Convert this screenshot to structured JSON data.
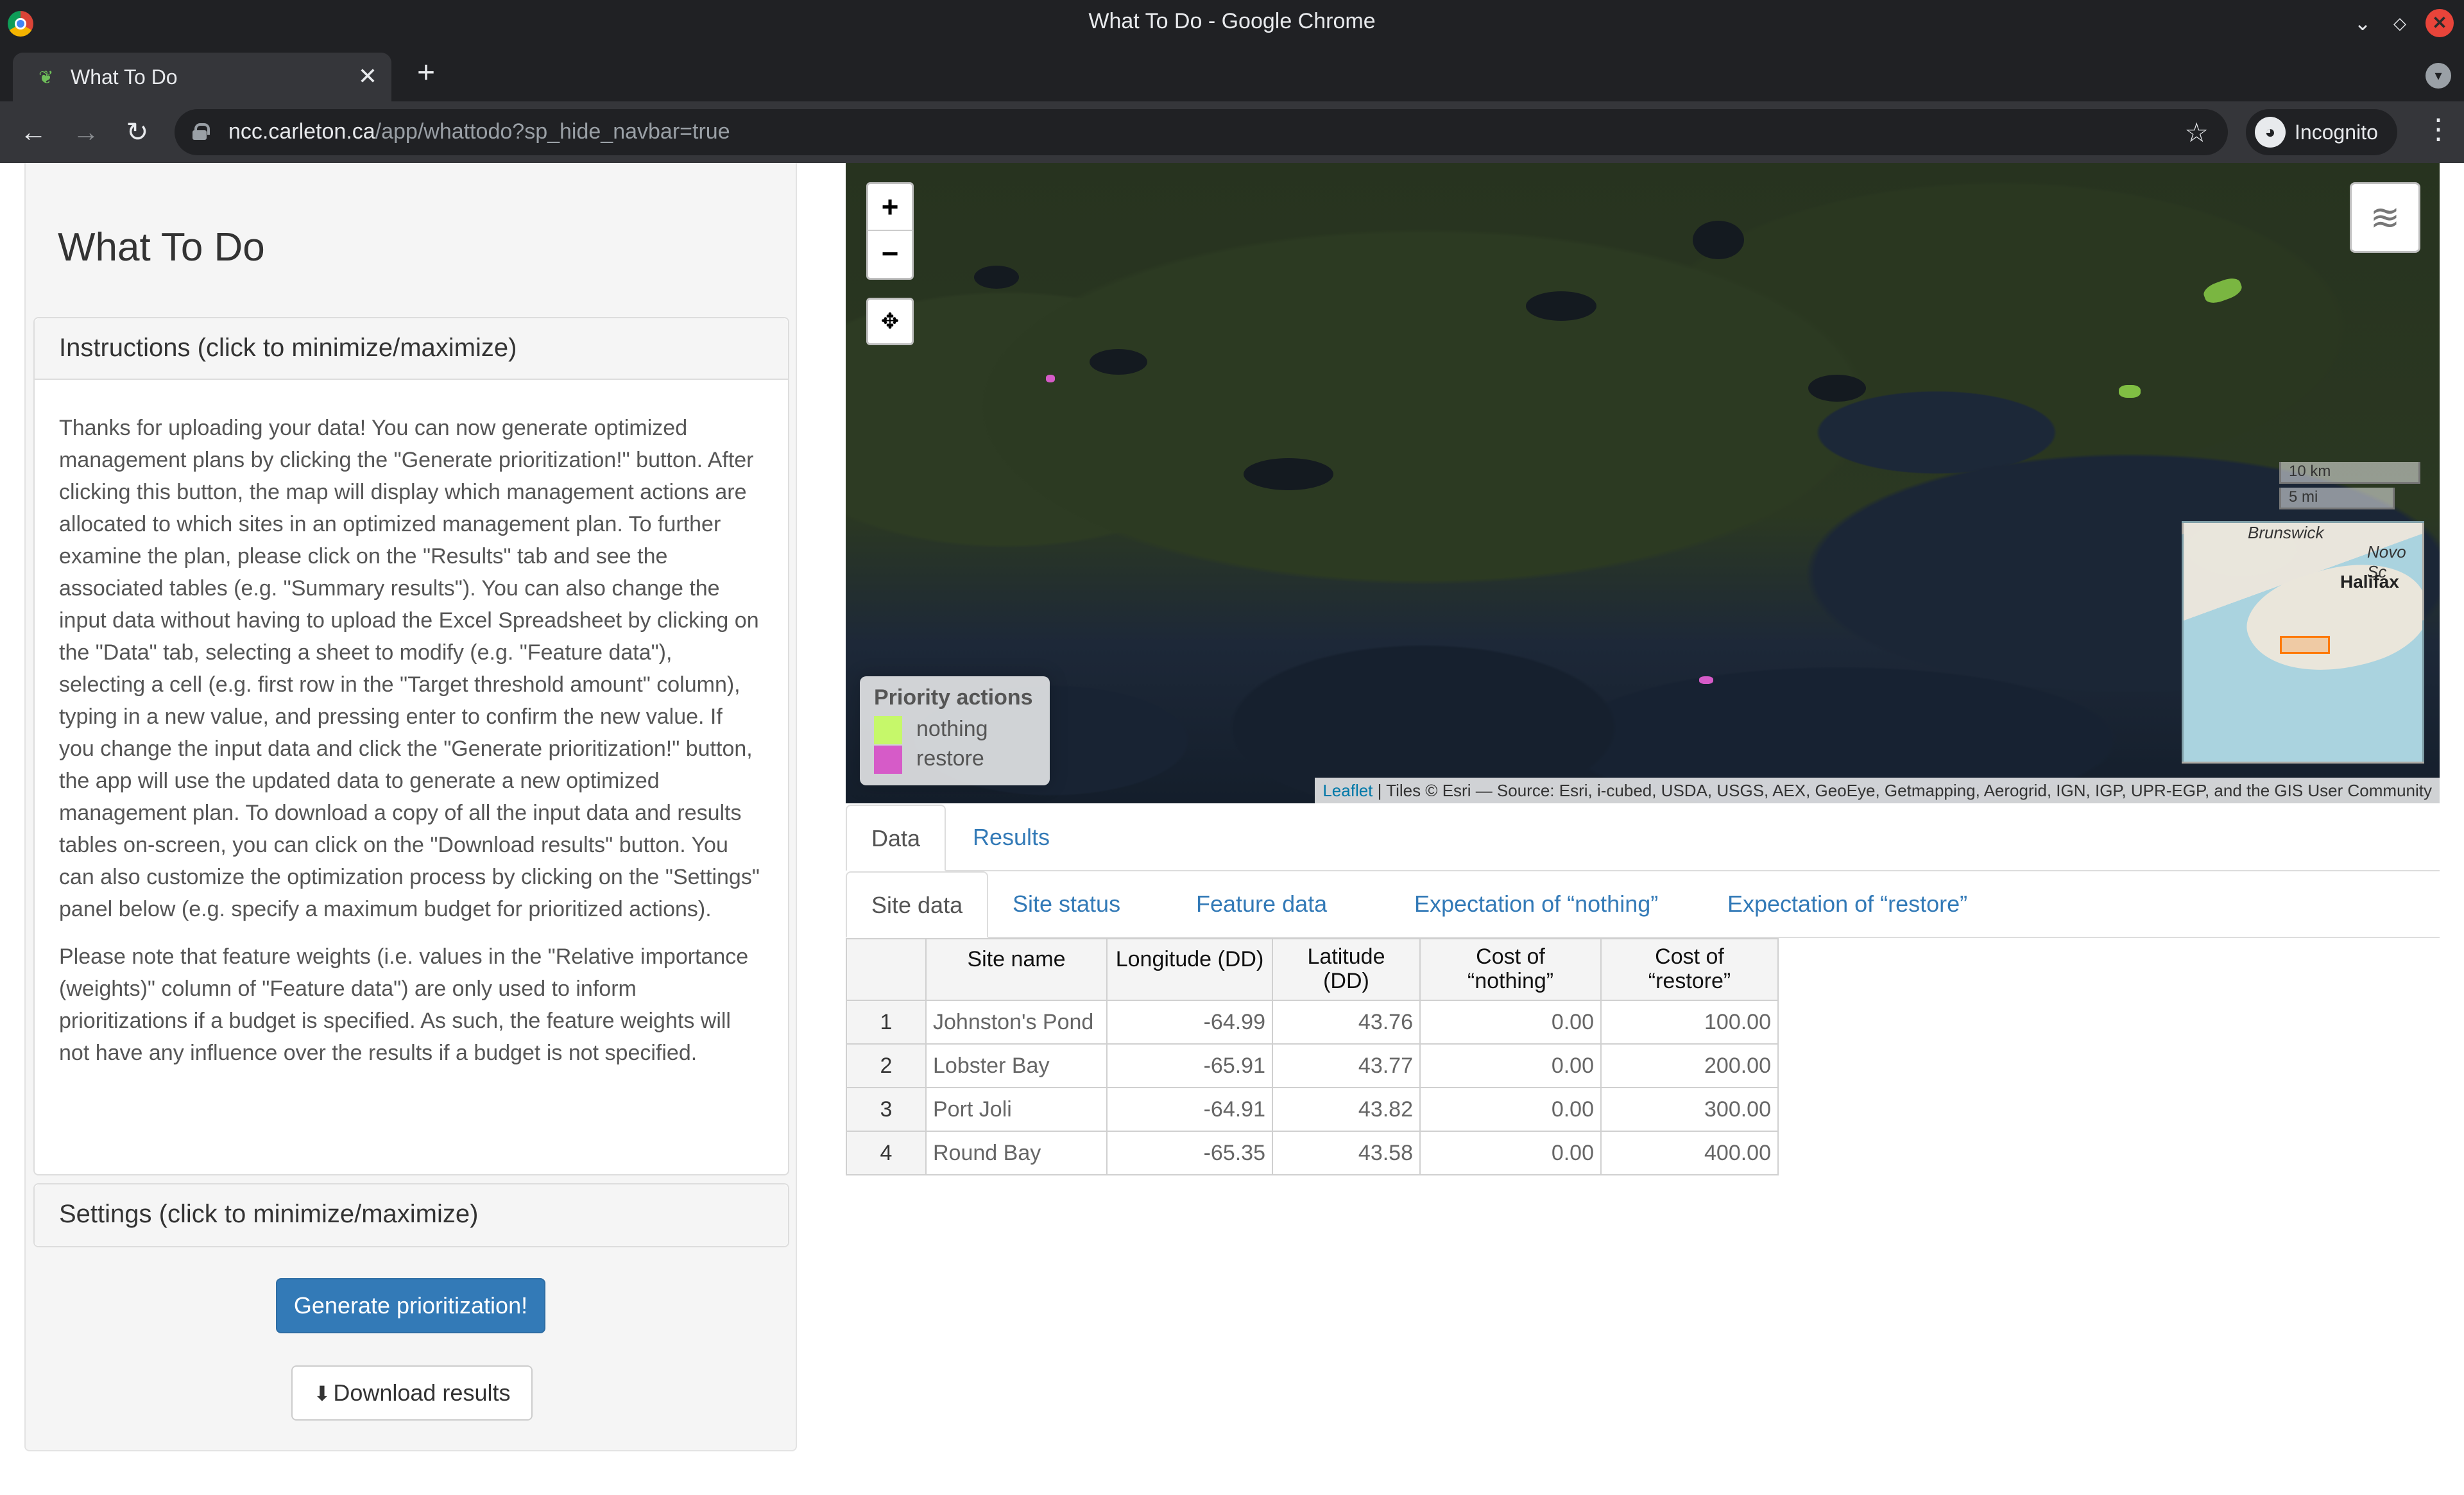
{
  "window": {
    "title": "What To Do - Google Chrome"
  },
  "browser": {
    "tab_title": "What To Do",
    "url_host": "ncc.carleton.ca",
    "url_path": "/app/whattodo?sp_hide_navbar=true",
    "incognito_label": "Incognito"
  },
  "sidebar": {
    "app_title": "What To Do",
    "instructions_header": "Instructions (click to minimize/maximize)",
    "instructions_p1": "Thanks for uploading your data! You can now generate optimized management plans by clicking the \"Generate prioritization!\" button. After clicking this button, the map will display which management actions are allocated to which sites in an optimized management plan. To further examine the plan, please click on the \"Results\" tab and see the associated tables (e.g. \"Summary results\"). You can also change the input data without having to upload the Excel Spreadsheet by clicking on the \"Data\" tab, selecting a sheet to modify (e.g. \"Feature data\"), selecting a cell (e.g. first row in the \"Target threshold amount\" column), typing in a new value, and pressing enter to confirm the new value. If you change the input data and click the \"Generate prioritization!\" button, the app will use the updated data to generate a new optimized management plan. To download a copy of all the input data and results tables on-screen, you can click on the \"Download results\" button. You can also customize the optimization process by clicking on the \"Settings\" panel below (e.g. specify a maximum budget for prioritized actions).",
    "instructions_p2": "Please note that feature weights (i.e. values in the \"Relative importance (weights)\" column of \"Feature data\") are only used to inform prioritizations if a budget is specified. As such, the feature weights will not have any influence over the results if a budget is not specified.",
    "settings_header": "Settings (click to minimize/maximize)",
    "generate_button": "Generate prioritization!",
    "download_button": "Download results"
  },
  "map": {
    "zoom_in": "+",
    "zoom_out": "−",
    "scale_km": "10 km",
    "scale_mi": "5 mi",
    "minimap_label_brunswick": "Brunswick",
    "minimap_label_novo": "Novo Sc",
    "minimap_label_halifax": "Halifax",
    "legend_title": "Priority actions",
    "legend_items": [
      {
        "label": "nothing",
        "color": "#c6f86a"
      },
      {
        "label": "restore",
        "color": "#d65bc8"
      }
    ],
    "attribution_link": "Leaflet",
    "attribution_text": " | Tiles © Esri — Source: Esri, i-cubed, USDA, USGS, AEX, GeoEye, Getmapping, Aerogrid, IGN, IGP, UPR-EGP, and the GIS User Community"
  },
  "tabs": {
    "main": [
      "Data",
      "Results"
    ],
    "sub": [
      "Site data",
      "Site status",
      "Feature data",
      "Expectation of “nothing”",
      "Expectation of “restore”"
    ]
  },
  "table": {
    "headers": [
      "",
      "Site name",
      "Longitude (DD)",
      "Latitude\n(DD)",
      "Cost of\n“nothing”",
      "Cost of\n“restore”"
    ],
    "rows": [
      [
        "1",
        "Johnston's Pond",
        "-64.99",
        "43.76",
        "0.00",
        "100.00"
      ],
      [
        "2",
        "Lobster Bay",
        "-65.91",
        "43.77",
        "0.00",
        "200.00"
      ],
      [
        "3",
        "Port Joli",
        "-64.91",
        "43.82",
        "0.00",
        "300.00"
      ],
      [
        "4",
        "Round Bay",
        "-65.35",
        "43.58",
        "0.00",
        "400.00"
      ]
    ]
  }
}
